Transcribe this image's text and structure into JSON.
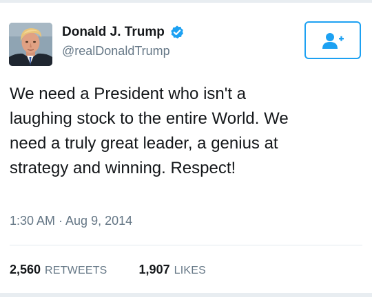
{
  "user": {
    "display_name": "Donald J. Trump",
    "handle": "@realDonaldTrump",
    "verified": true
  },
  "follow_button": {
    "icon": "follow-user-icon"
  },
  "tweet": {
    "text": "We need a President who isn't a\nlaughing stock to the entire World. We\nneed a truly great leader, a genius at\nstrategy and winning. Respect!",
    "timestamp": "1:30 AM · Aug 9, 2014"
  },
  "stats": {
    "retweets_count": "2,560",
    "retweets_label": "RETWEETS",
    "likes_count": "1,907",
    "likes_label": "LIKES"
  },
  "colors": {
    "accent": "#1da1f2",
    "text_primary": "#14171a",
    "text_secondary": "#657786"
  }
}
